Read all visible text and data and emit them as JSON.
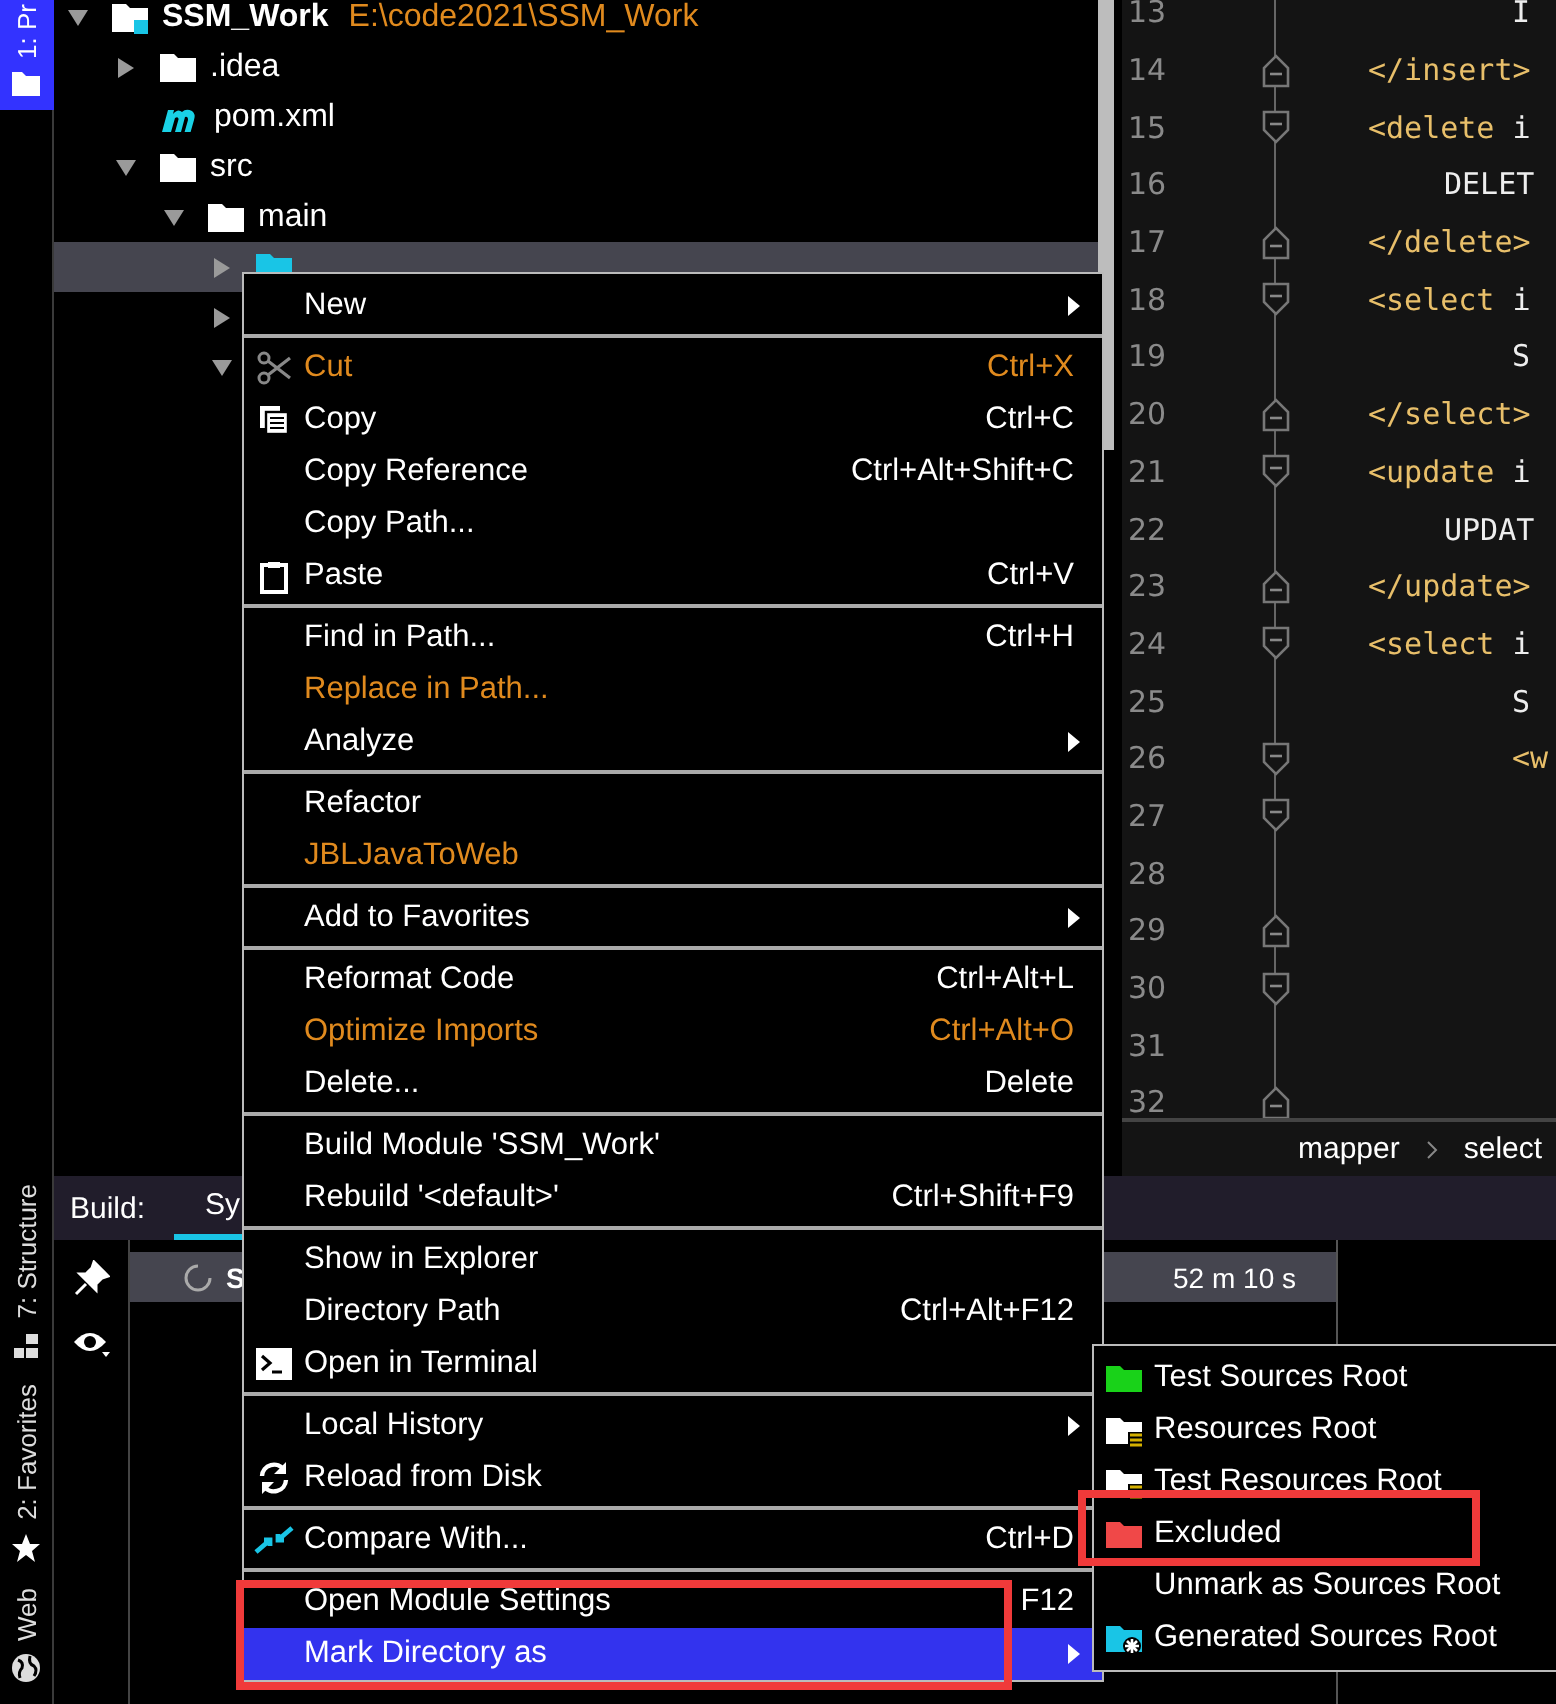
{
  "tool_strip": [
    {
      "label": "1: Pr",
      "selected": true
    },
    {
      "label": "7: Structure",
      "selected": false
    },
    {
      "label": "2: Favorites",
      "selected": false
    },
    {
      "label": "Web",
      "selected": false
    }
  ],
  "project_tree": {
    "items": [
      {
        "label": "SSM_Work",
        "path": "E:\\code2021\\SSM_Work",
        "kind": "module",
        "expanded": true,
        "selected": false,
        "children": [
          {
            "label": ".idea",
            "kind": "folder",
            "expanded": false,
            "selected": false
          },
          {
            "label": "pom.xml",
            "kind": "maven",
            "selected": false
          },
          {
            "label": "src",
            "kind": "folder",
            "expanded": true,
            "selected": false,
            "children": [
              {
                "label": "main",
                "kind": "folder",
                "expanded": true,
                "selected": false,
                "children": [
                  {
                    "kind": "source_folder",
                    "expanded": false,
                    "selected": true
                  },
                  {
                    "expanded": false,
                    "selected": false
                  },
                  {
                    "expanded": true,
                    "selected": false
                  }
                ]
              }
            ]
          }
        ]
      }
    ]
  },
  "editor": {
    "lines": [
      {
        "number": "13",
        "kind": "clause",
        "text": "I",
        "fold_start": false,
        "fold_end": false
      },
      {
        "number": "14",
        "kind": "tag",
        "tag": "</insert>",
        "fold_start": false,
        "fold_end": true
      },
      {
        "number": "15",
        "kind": "tag",
        "tag": "<delete",
        "text": " i",
        "fold_start": true,
        "fold_end": false
      },
      {
        "number": "16",
        "kind": "statement",
        "text": "DELET",
        "fold_start": false,
        "fold_end": false
      },
      {
        "number": "17",
        "kind": "tag",
        "tag": "</delete>",
        "fold_start": false,
        "fold_end": true
      },
      {
        "number": "18",
        "kind": "tag",
        "tag": "<select",
        "text": " i",
        "fold_start": true,
        "fold_end": false
      },
      {
        "number": "19",
        "kind": "clause",
        "text": "S",
        "fold_start": false,
        "fold_end": false
      },
      {
        "number": "20",
        "kind": "tag",
        "tag": "</select>",
        "fold_start": false,
        "fold_end": true
      },
      {
        "number": "21",
        "kind": "tag",
        "tag": "<update",
        "text": " i",
        "fold_start": true,
        "fold_end": false
      },
      {
        "number": "22",
        "kind": "statement",
        "text": "UPDAT",
        "fold_start": false,
        "fold_end": false
      },
      {
        "number": "23",
        "kind": "tag",
        "tag": "</update>",
        "fold_start": false,
        "fold_end": true
      },
      {
        "number": "24",
        "kind": "tag",
        "tag": "<select",
        "text": " i",
        "fold_start": true,
        "fold_end": false
      },
      {
        "number": "25",
        "kind": "clause",
        "text": "S",
        "fold_start": false,
        "fold_end": false
      },
      {
        "number": "26",
        "kind": "clause",
        "tag": "<w",
        "fold_start": true,
        "fold_end": false
      },
      {
        "number": "27",
        "fold_start": true,
        "fold_end": false
      },
      {
        "number": "28",
        "fold_start": false,
        "fold_end": false
      },
      {
        "number": "29",
        "fold_start": false,
        "fold_end": true
      },
      {
        "number": "30",
        "fold_start": true,
        "fold_end": false
      },
      {
        "number": "31",
        "fold_start": false,
        "fold_end": false
      },
      {
        "number": "32",
        "fold_start": false,
        "fold_end": true
      }
    ],
    "breadcrumbs": [
      "mapper",
      "select"
    ]
  },
  "build_panel": {
    "label": "Build:",
    "tabs": [
      {
        "label": "Sy",
        "selected": true
      }
    ],
    "rows": [
      {
        "label": "S",
        "time": "52 m 10 s",
        "selected": true
      }
    ]
  },
  "context_menu": {
    "groups": [
      [
        {
          "label": "New",
          "submenu": true,
          "selected": false
        }
      ],
      [
        {
          "label": "Cut",
          "shortcut": "Ctrl+X",
          "kind": "cut",
          "accent": true,
          "selected": false
        },
        {
          "label": "Copy",
          "shortcut": "Ctrl+C",
          "kind": "copy",
          "selected": false
        },
        {
          "label": "Copy Reference",
          "shortcut": "Ctrl+Alt+Shift+C",
          "selected": false
        },
        {
          "label": "Copy Path...",
          "selected": false
        },
        {
          "label": "Paste",
          "shortcut": "Ctrl+V",
          "kind": "paste",
          "selected": false
        }
      ],
      [
        {
          "label": "Find in Path...",
          "shortcut": "Ctrl+H",
          "selected": false
        },
        {
          "label": "Replace in Path...",
          "accent": true,
          "selected": false
        },
        {
          "label": "Analyze",
          "submenu": true,
          "selected": false
        }
      ],
      [
        {
          "label": "Refactor",
          "selected": false
        },
        {
          "label": "JBLJavaToWeb",
          "accent": true,
          "selected": false
        }
      ],
      [
        {
          "label": "Add to Favorites",
          "submenu": true,
          "selected": false
        }
      ],
      [
        {
          "label": "Reformat Code",
          "shortcut": "Ctrl+Alt+L",
          "selected": false
        },
        {
          "label": "Optimize Imports",
          "shortcut": "Ctrl+Alt+O",
          "accent": true,
          "selected": false
        },
        {
          "label": "Delete...",
          "shortcut": "Delete",
          "selected": false
        }
      ],
      [
        {
          "label": "Build Module 'SSM_Work'",
          "selected": false
        },
        {
          "label": "Rebuild '<default>'",
          "shortcut": "Ctrl+Shift+F9",
          "selected": false
        }
      ],
      [
        {
          "label": "Show in Explorer",
          "selected": false
        },
        {
          "label": "Directory Path",
          "shortcut": "Ctrl+Alt+F12",
          "selected": false
        },
        {
          "label": "Open in Terminal",
          "kind": "terminal",
          "selected": false
        }
      ],
      [
        {
          "label": "Local History",
          "submenu": true,
          "selected": false
        },
        {
          "label": "Reload from Disk",
          "kind": "reload",
          "selected": false
        }
      ],
      [
        {
          "label": "Compare With...",
          "shortcut": "Ctrl+D",
          "kind": "compare",
          "selected": false
        }
      ],
      [
        {
          "label": "Open Module Settings",
          "shortcut": "F12",
          "selected": false
        },
        {
          "label": "Mark Directory as",
          "submenu": true,
          "selected": true
        }
      ]
    ]
  },
  "mark_directory_submenu": {
    "items": [
      {
        "label": "Test Sources Root",
        "kind": "test_sources"
      },
      {
        "label": "Resources Root",
        "kind": "resources"
      },
      {
        "label": "Test Resources Root",
        "kind": "test_resources"
      },
      {
        "label": "Excluded",
        "kind": "excluded"
      },
      {
        "label": "Unmark as Sources Root",
        "kind": "plain"
      },
      {
        "label": "Generated Sources Root",
        "kind": "generated"
      }
    ]
  }
}
